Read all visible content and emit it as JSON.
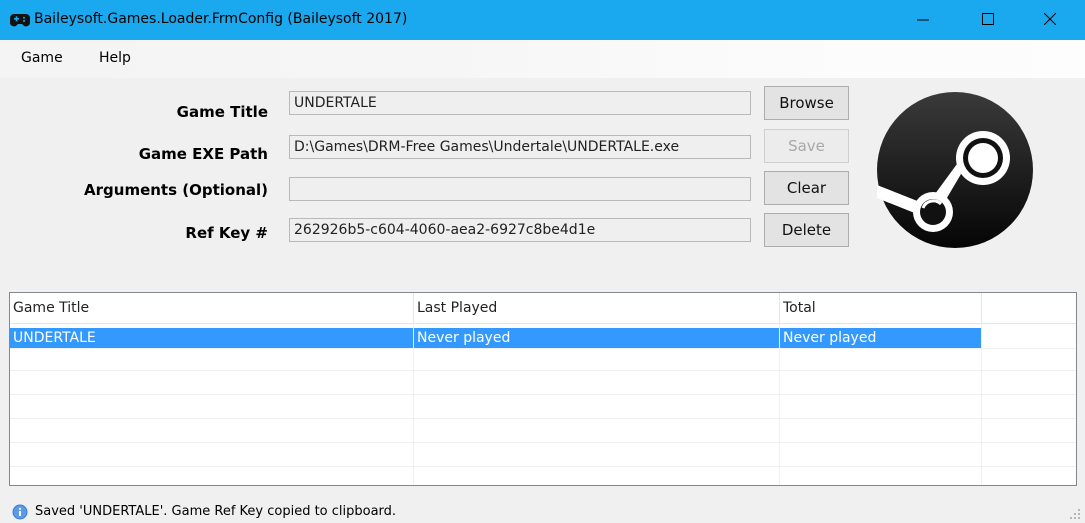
{
  "window": {
    "title": "Baileysoft.Games.Loader.FrmConfig (Baileysoft 2017)",
    "icon": "gamepad-icon",
    "accent_color": "#1aa9ef"
  },
  "menu": {
    "items": [
      {
        "label": "Game"
      },
      {
        "label": "Help"
      }
    ]
  },
  "form": {
    "game_title_label": "Game Title",
    "game_title_value": "UNDERTALE",
    "exe_path_label": "Game EXE Path",
    "exe_path_value": "D:\\Games\\DRM-Free Games\\Undertale\\UNDERTALE.exe",
    "arguments_label": "Arguments (Optional)",
    "arguments_value": "",
    "ref_key_label": "Ref Key #",
    "ref_key_value": "262926b5-c604-4060-aea2-6927c8be4d1e"
  },
  "buttons": {
    "browse": "Browse",
    "save": "Save",
    "clear": "Clear",
    "delete": "Delete"
  },
  "logo": {
    "icon": "steam-logo-icon"
  },
  "list": {
    "columns": [
      "Game Title",
      "Last Played",
      "Total"
    ],
    "rows": [
      {
        "title": "UNDERTALE",
        "last_played": "Never played",
        "total": "Never played",
        "selected": true
      }
    ],
    "selection_color": "#3399ff"
  },
  "status": {
    "icon": "info-icon",
    "text": "Saved 'UNDERTALE'. Game Ref Key copied to clipboard."
  }
}
